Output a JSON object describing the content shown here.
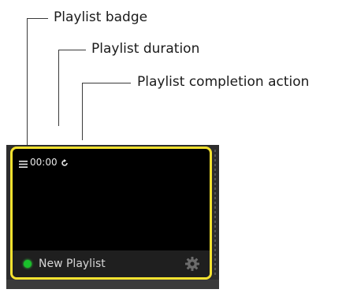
{
  "callouts": {
    "badge": "Playlist badge",
    "duration": "Playlist duration",
    "completion": "Playlist completion action"
  },
  "tile": {
    "duration": "00:00",
    "name": "New Playlist",
    "badge_icon": "list-icon",
    "completion_icon": "loop-icon",
    "settings_icon": "gear-icon",
    "status": "active",
    "colors": {
      "border": "#f5e230",
      "status_dot": "#19c12b",
      "tile_bg": "#000000",
      "footer_bg": "#1f1f1f"
    }
  }
}
